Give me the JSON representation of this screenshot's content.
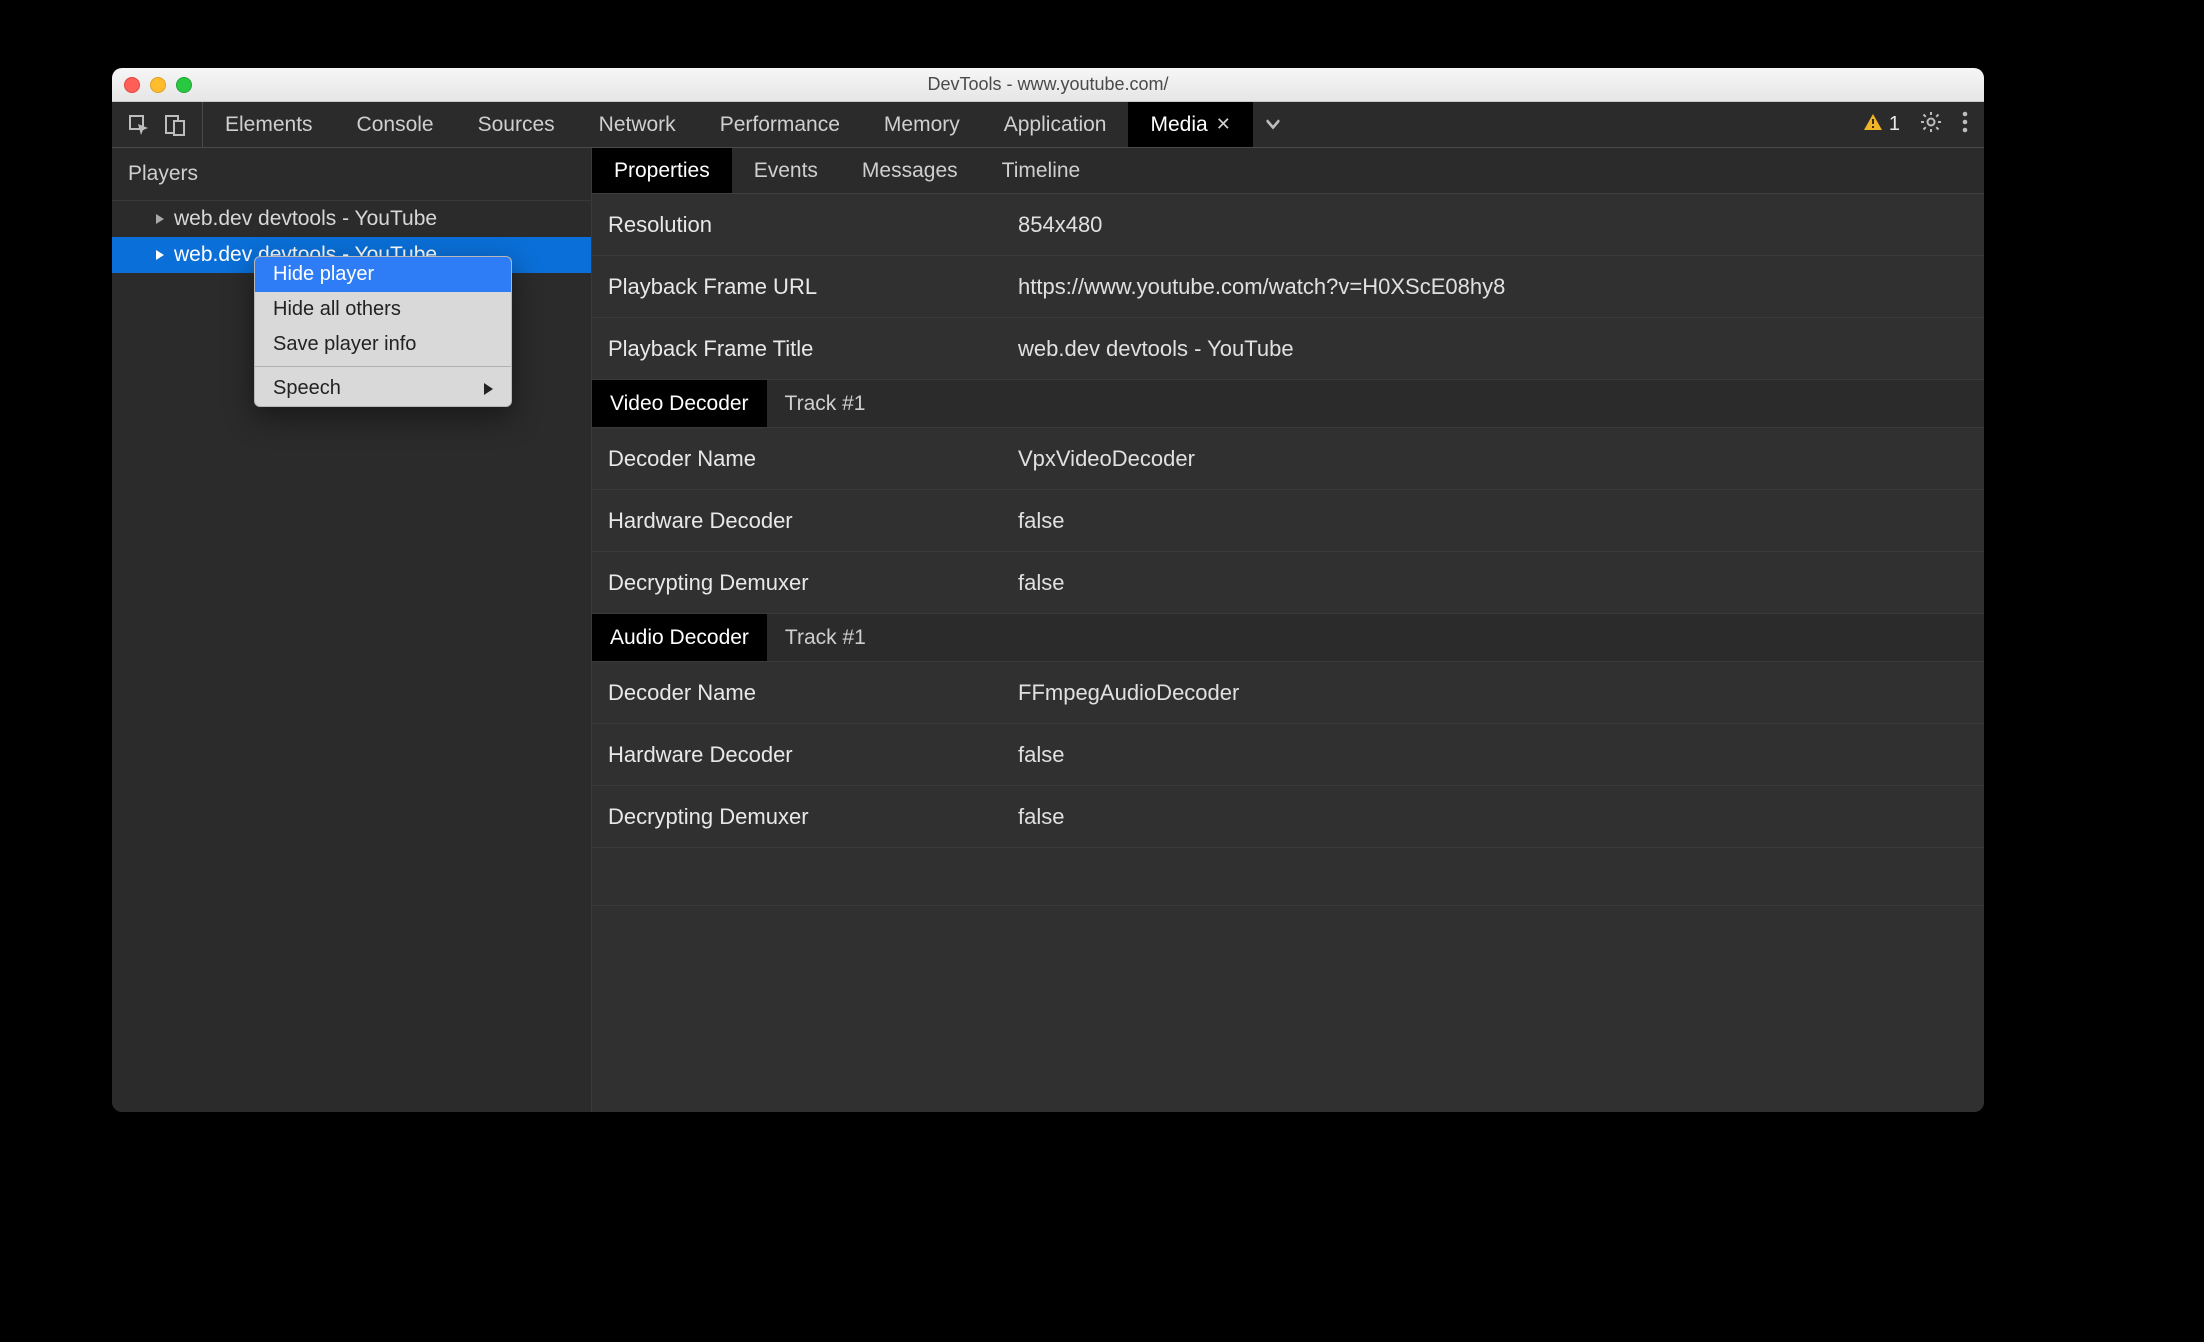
{
  "window": {
    "title": "DevTools - www.youtube.com/"
  },
  "panels": {
    "items": [
      "Elements",
      "Console",
      "Sources",
      "Network",
      "Performance",
      "Memory",
      "Application",
      "Media"
    ],
    "active": "Media"
  },
  "warnings": {
    "count": "1"
  },
  "sidebar": {
    "title": "Players",
    "players": [
      {
        "label": "web.dev devtools - YouTube"
      },
      {
        "label": "web.dev devtools - YouTube"
      }
    ]
  },
  "context_menu": {
    "items": [
      "Hide player",
      "Hide all others",
      "Save player info"
    ],
    "speech": "Speech"
  },
  "subtabs": {
    "items": [
      "Properties",
      "Events",
      "Messages",
      "Timeline"
    ],
    "active": "Properties"
  },
  "props": {
    "general": [
      {
        "key": "Resolution",
        "val": "854x480"
      },
      {
        "key": "Playback Frame URL",
        "val": "https://www.youtube.com/watch?v=H0XScE08hy8"
      },
      {
        "key": "Playback Frame Title",
        "val": "web.dev devtools - YouTube"
      }
    ],
    "video": {
      "label": "Video Decoder",
      "track": "Track #1",
      "rows": [
        {
          "key": "Decoder Name",
          "val": "VpxVideoDecoder"
        },
        {
          "key": "Hardware Decoder",
          "val": "false"
        },
        {
          "key": "Decrypting Demuxer",
          "val": "false"
        }
      ]
    },
    "audio": {
      "label": "Audio Decoder",
      "track": "Track #1",
      "rows": [
        {
          "key": "Decoder Name",
          "val": "FFmpegAudioDecoder"
        },
        {
          "key": "Hardware Decoder",
          "val": "false"
        },
        {
          "key": "Decrypting Demuxer",
          "val": "false"
        }
      ]
    }
  }
}
